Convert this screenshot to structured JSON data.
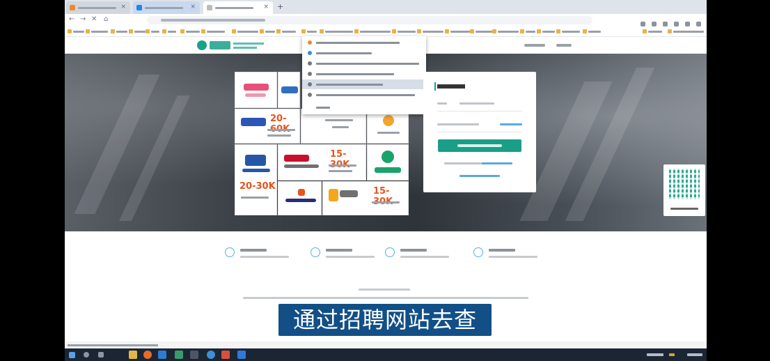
{
  "subtitle": "通过招聘网站去查",
  "colors": {
    "brand": "#1aa18a",
    "salary": "#e8541c",
    "subtitle_bg": "#124f86",
    "taskbar": "#1b2634"
  },
  "salary_tags": [
    "20-60K",
    "15-30K",
    "20-30K",
    "15-30K"
  ],
  "icons": [
    "new-tab-icon",
    "back-icon",
    "forward-icon",
    "reload-icon",
    "windows-start-icon",
    "search-icon",
    "firefox-icon",
    "qr-code-icon"
  ]
}
